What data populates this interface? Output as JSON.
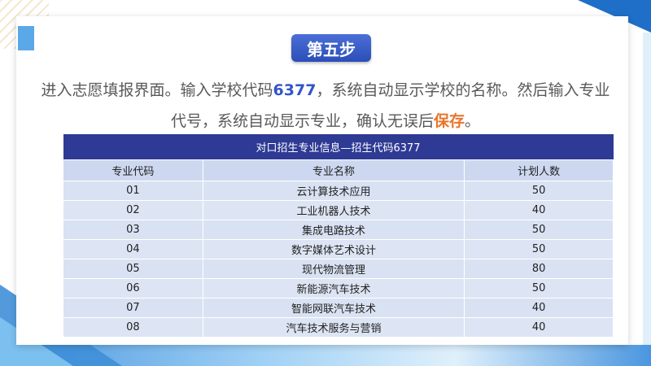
{
  "step_label": "第五步",
  "instruction": {
    "part1": "进入志愿填报界面。输入学校代码",
    "school_code": "6377",
    "part2": "，系统自动显示学校的名称。然后输入专业代号，系统自动显示专业，确认无误后",
    "save_word": "保存",
    "part3": "。"
  },
  "table": {
    "caption": "对口招生专业信息—招生代码6377",
    "headers": [
      "专业代码",
      "专业名称",
      "计划人数"
    ],
    "rows": [
      [
        "01",
        "云计算技术应用",
        "50"
      ],
      [
        "02",
        "工业机器人技术",
        "40"
      ],
      [
        "03",
        "集成电路技术",
        "50"
      ],
      [
        "04",
        "数字媒体艺术设计",
        "50"
      ],
      [
        "05",
        "现代物流管理",
        "80"
      ],
      [
        "06",
        "新能源汽车技术",
        "50"
      ],
      [
        "07",
        "智能网联汽车技术",
        "40"
      ],
      [
        "08",
        "汽车技术服务与营销",
        "40"
      ]
    ]
  },
  "colors": {
    "badge": "#3a5cc8",
    "table_header": "#2e3a93",
    "table_row": "#d9e2f3",
    "code_highlight": "#3355c8",
    "save_highlight": "#e8762c"
  }
}
